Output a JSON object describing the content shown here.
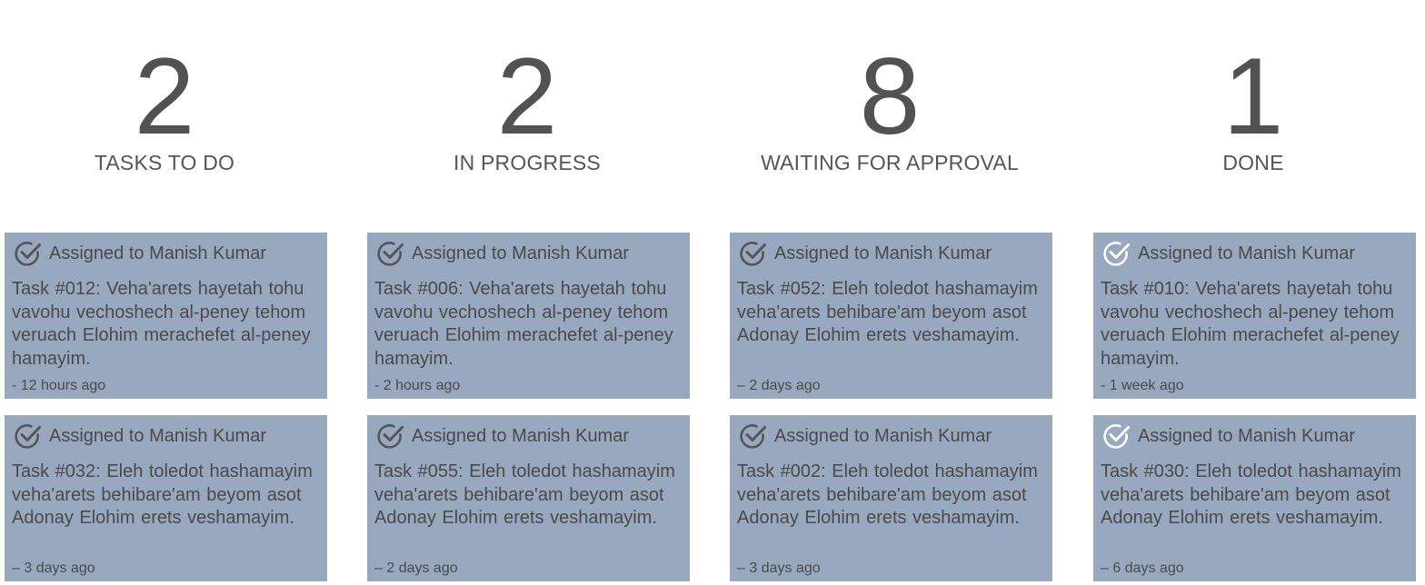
{
  "columns": [
    {
      "count": "2",
      "label": "TASKS TO DO",
      "cards": [
        {
          "assignee": "Assigned to Manish Kumar",
          "text": "Task #012: Veha'arets hayetah tohu vavohu vechoshech al-peney tehom veruach Elohim merachefet al-peney hamayim.",
          "time": "- 12 hours ago",
          "icon": "check-circle-icon",
          "icon_color": "#555555"
        },
        {
          "assignee": "Assigned to Manish Kumar",
          "text": "Task #032: Eleh toledot hashamayim veha'arets behibare'am beyom asot Adonay Elohim erets veshamayim.",
          "time": "– 3 days ago",
          "icon": "check-circle-icon",
          "icon_color": "#555555"
        }
      ]
    },
    {
      "count": "2",
      "label": "IN PROGRESS",
      "cards": [
        {
          "assignee": "Assigned to Manish Kumar",
          "text": "Task #006: Veha'arets hayetah tohu vavohu vechoshech al-peney tehom veruach Elohim merachefet al-peney hamayim.",
          "time": "- 2 hours ago",
          "icon": "check-circle-icon",
          "icon_color": "#555555"
        },
        {
          "assignee": "Assigned to Manish Kumar",
          "text": "Task #055: Eleh toledot hashamayim veha'arets behibare'am beyom asot Adonay Elohim erets veshamayim.",
          "time": "– 2 days ago",
          "icon": "check-circle-icon",
          "icon_color": "#555555"
        }
      ]
    },
    {
      "count": "8",
      "label": "WAITING FOR APPROVAL",
      "cards": [
        {
          "assignee": "Assigned to Manish Kumar",
          "text": "Task #052: Eleh toledot hashamayim veha'arets behibare'am beyom asot Adonay Elohim erets veshamayim.",
          "time": "– 2 days ago",
          "icon": "check-circle-icon",
          "icon_color": "#555555"
        },
        {
          "assignee": "Assigned to Manish Kumar",
          "text": "Task #002: Eleh toledot hashamayim veha'arets behibare'am beyom asot Adonay Elohim erets veshamayim.",
          "time": "– 3 days ago",
          "icon": "check-circle-icon",
          "icon_color": "#555555"
        }
      ]
    },
    {
      "count": "1",
      "label": "DONE",
      "cards": [
        {
          "assignee": "Assigned to Manish Kumar",
          "text": "Task #010: Veha'arets hayetah tohu vavohu vechoshech al-peney tehom veruach Elohim merachefet al-peney hamayim.",
          "time": "- 1 week ago",
          "icon": "check-circle-icon",
          "icon_color": "#ffffff"
        },
        {
          "assignee": "Assigned to Manish Kumar",
          "text": "Task #030: Eleh toledot hashamayim veha'arets behibare'am beyom asot Adonay Elohim erets veshamayim.",
          "time": "– 6 days ago",
          "icon": "check-circle-icon",
          "icon_color": "#ffffff"
        }
      ]
    }
  ],
  "colors": {
    "card_background": "#97a8bf",
    "count_text": "#525252",
    "label_text": "#555555"
  }
}
